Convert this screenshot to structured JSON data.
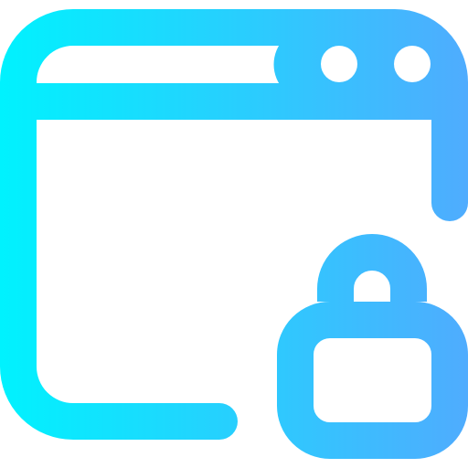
{
  "icon": {
    "name": "browser-window-lock-icon",
    "colors": {
      "gradient_start": "#00F2FE",
      "gradient_end": "#4FACFE",
      "background": "#FFFFFF"
    },
    "parts": {
      "window": "browser-window-icon",
      "dots": "window-control-dots",
      "lock": "padlock-icon"
    }
  }
}
